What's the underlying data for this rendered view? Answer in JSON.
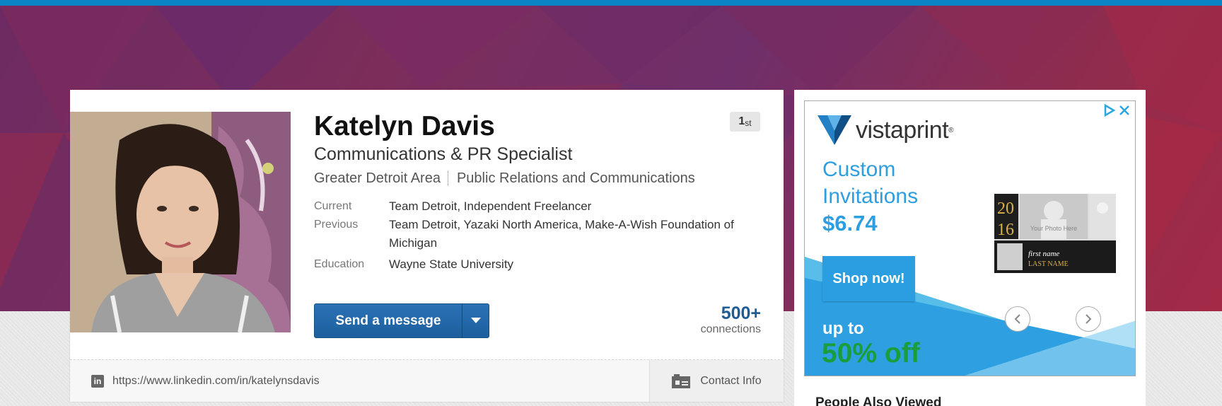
{
  "profile": {
    "name": "Katelyn Davis",
    "headline": "Communications & PR Specialist",
    "location": "Greater Detroit Area",
    "industry": "Public Relations and Communications",
    "degree": "1",
    "degree_suffix": "st",
    "rows": [
      {
        "label": "Current",
        "value": "Team Detroit, Independent Freelancer"
      },
      {
        "label": "Previous",
        "value": "Team Detroit, Yazaki North America, Make-A-Wish Foundation of Michigan"
      },
      {
        "label": "Education",
        "value": "Wayne State University"
      }
    ],
    "send_message_label": "Send a message",
    "connections_count": "500+",
    "connections_label": "connections",
    "public_url": "https://www.linkedin.com/in/katelynsdavis",
    "contact_info_label": "Contact Info"
  },
  "ad": {
    "brand": "vistaprint",
    "brand_mark": "®",
    "line1": "Custom",
    "line2": "Invitations",
    "price": "$6.74",
    "cta": "Shop now!",
    "promo_line1": "up to",
    "promo_line2": "50% off",
    "sample": {
      "year_top": "20",
      "year_bottom": "16",
      "photo_text": "Your Photo Here",
      "first_name": "first name",
      "last_name": "LAST NAME"
    }
  },
  "sidebar": {
    "people_also_viewed": "People Also Viewed"
  },
  "colors": {
    "brand_blue": "#0b84c6",
    "button_blue": "#1d5f9e",
    "ad_blue": "#2d9fe0",
    "ad_green": "#1a9e3c"
  }
}
